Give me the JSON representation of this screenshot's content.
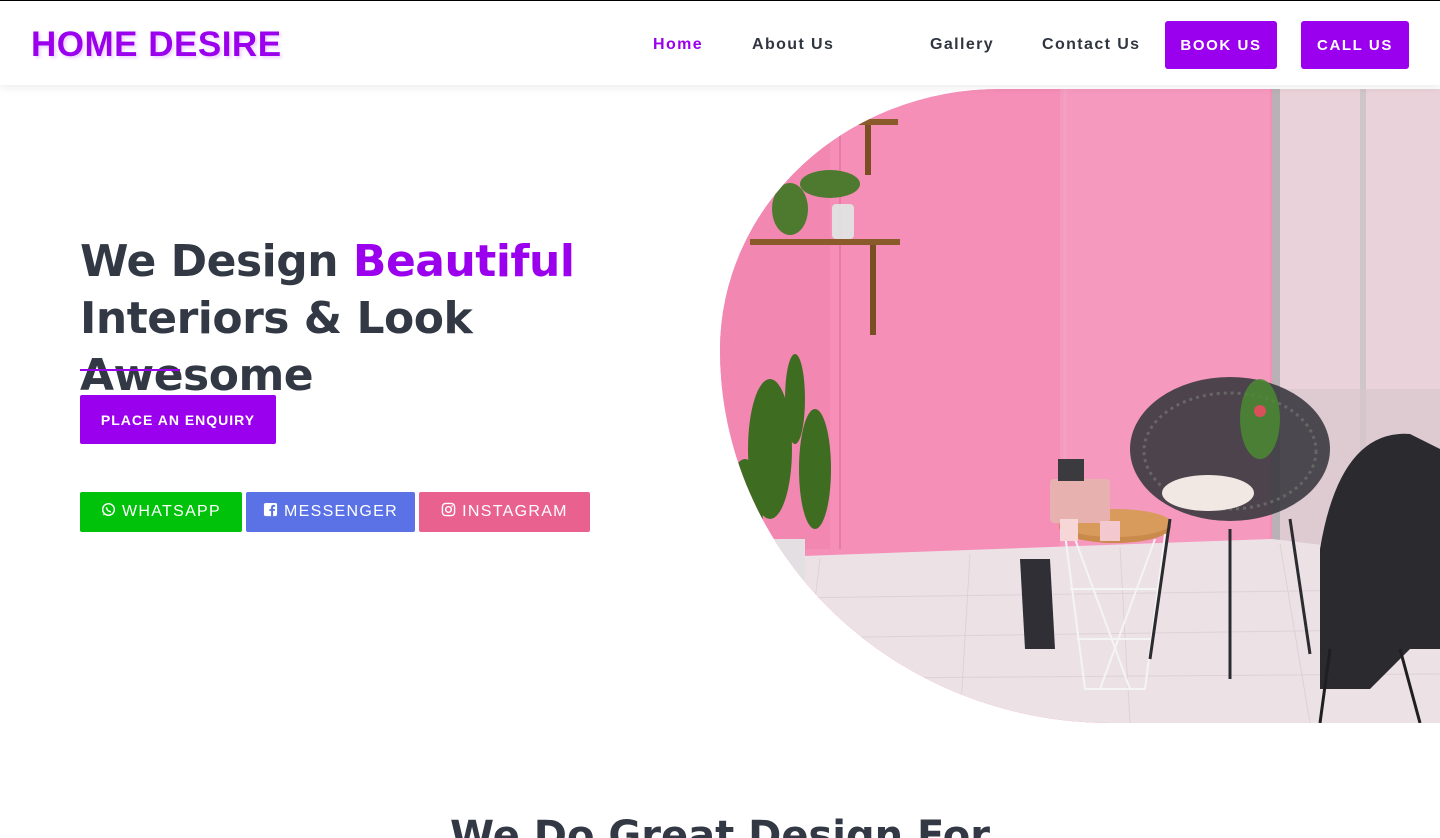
{
  "brand": {
    "logo_text": "HOME DESIRE",
    "accent_color": "#9b00ee"
  },
  "nav": {
    "links": [
      {
        "label": "Home",
        "active": true
      },
      {
        "label": "About Us",
        "active": false
      },
      {
        "label": "Gallery",
        "active": false
      },
      {
        "label": "Contact Us",
        "active": false
      }
    ],
    "book_label": "BOOK US",
    "call_label": "CALL US"
  },
  "hero": {
    "headline_part1": "We Design ",
    "headline_accent": "Beautiful",
    "headline_part2": "Interiors & Look Awesome",
    "enquiry_label": "PLACE AN ENQUIRY",
    "social": [
      {
        "label": "WHATSAPP",
        "icon": "whatsapp-icon",
        "color": "#00c20b"
      },
      {
        "label": "MESSENGER",
        "icon": "facebook-icon",
        "color": "#5a72e6"
      },
      {
        "label": "INSTAGRAM",
        "icon": "instagram-icon",
        "color": "#e8618f"
      }
    ],
    "image_subject": "pink-wall-interior-with-chairs-and-plants"
  },
  "section": {
    "title": "We Do Great Design For"
  }
}
